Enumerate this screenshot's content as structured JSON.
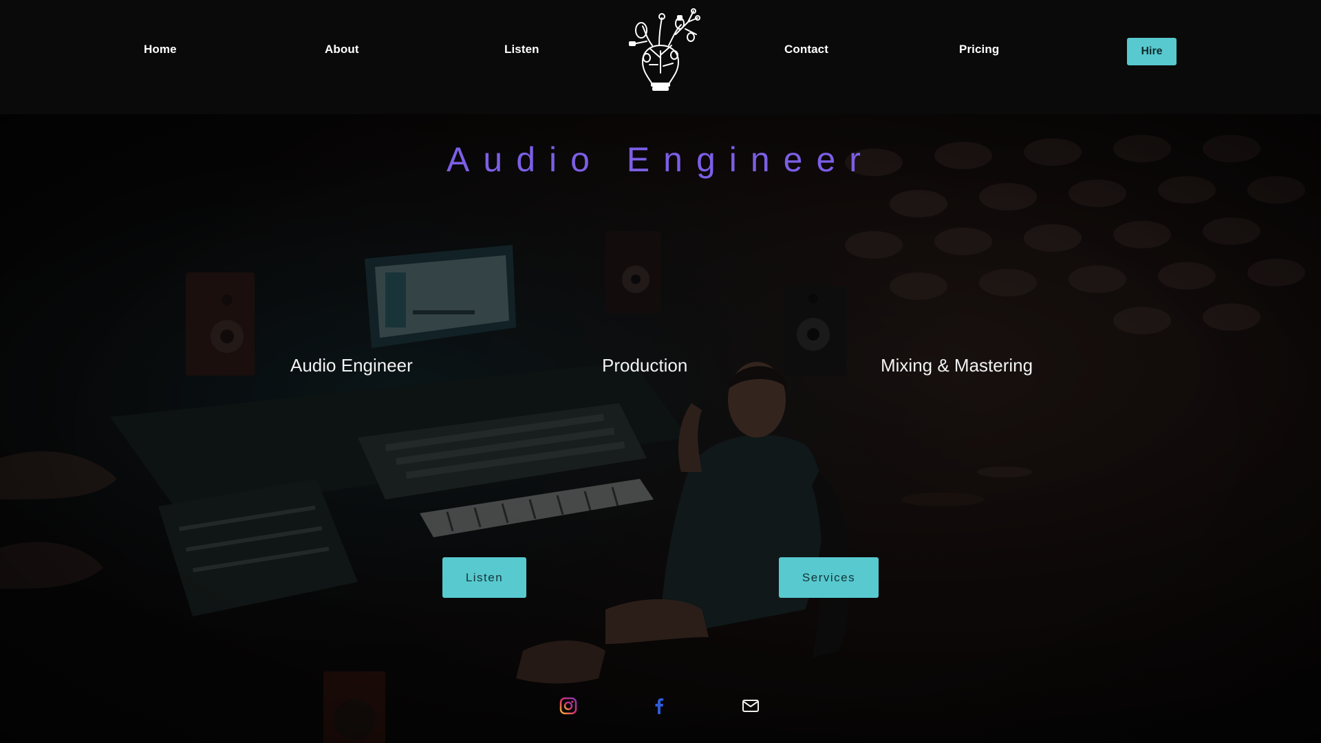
{
  "nav": {
    "home": "Home",
    "about": "About",
    "listen": "Listen",
    "contact": "Contact",
    "pricing": "Pricing",
    "hire": "Hire"
  },
  "hero": {
    "title": "Audio Engineer",
    "services": [
      "Audio Engineer",
      "Production",
      "Mixing & Mastering"
    ],
    "buttons": {
      "listen": "Listen",
      "services": "Services"
    }
  },
  "social": {
    "icons": [
      "instagram-icon",
      "facebook-icon",
      "mail-icon"
    ]
  },
  "colors": {
    "accent": "#57c9cf",
    "title": "#7c5fe6",
    "background": "#080808"
  }
}
